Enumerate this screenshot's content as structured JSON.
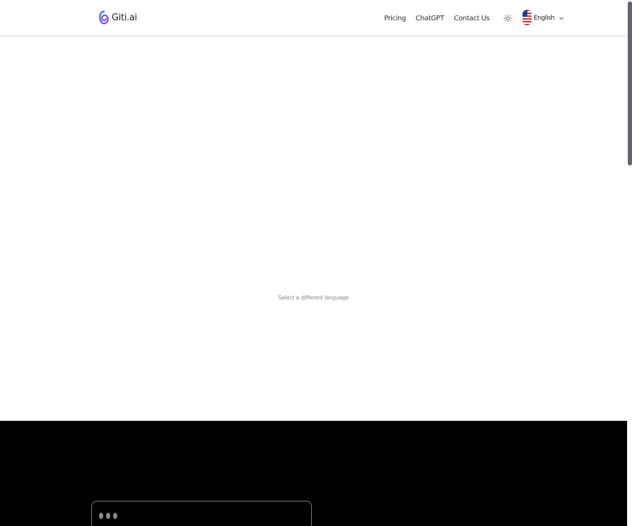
{
  "header": {
    "logo_text": "Giti.ai",
    "nav": {
      "pricing": "Pricing",
      "chatgpt": "ChatGPT",
      "contact": "Contact Us"
    },
    "theme_icon": "sun-icon",
    "language": {
      "label": "English",
      "flag_icon": "us-flag-icon",
      "chevron_icon": "chevron-down-icon"
    }
  },
  "main": {
    "language_hint": "Select a different language"
  },
  "footer": {
    "window_dots_icon": "window-dots-icon"
  },
  "colors": {
    "background": "#ffffff",
    "footer_background": "#000000",
    "scroll_thumb": "#5f6672",
    "hint_text": "#8a8a8a",
    "logo_gradient_start": "#2f6bff",
    "logo_gradient_end": "#a13bff"
  }
}
